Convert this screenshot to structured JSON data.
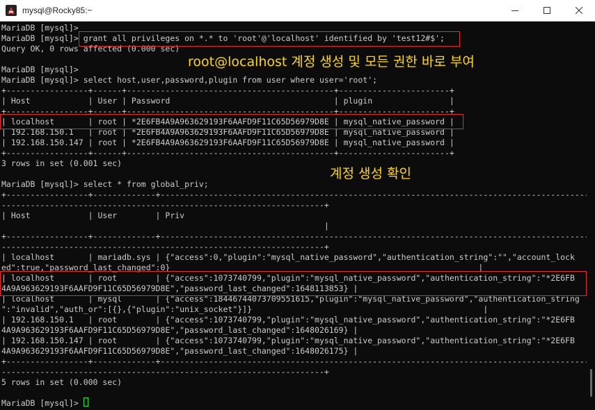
{
  "window": {
    "title": "mysql@Rocky85:~",
    "min_label": "minimize",
    "max_label": "maximize",
    "close_label": "close"
  },
  "terminal": {
    "lines": [
      "MariaDB [mysql]>",
      "MariaDB [mysql]> grant all privileges on *.* to 'root'@'localhost' identified by 'test12#$';",
      "Query OK, 0 rows affected (0.000 sec)",
      "",
      "MariaDB [mysql]>",
      "MariaDB [mysql]> select host,user,password,plugin from user where user='root';",
      "+-----------------+------+-------------------------------------------+-----------------------+",
      "| Host            | User | Password                                  | plugin                |",
      "+-----------------+------+-------------------------------------------+-----------------------+",
      "| localhost       | root | *2E6FB4A9A963629193F6AAFD9F11C65D56979D8E | mysql_native_password |",
      "| 192.168.150.1   | root | *2E6FB4A9A963629193F6AAFD9F11C65D56979D8E | mysql_native_password |",
      "| 192.168.150.147 | root | *2E6FB4A9A963629193F6AAFD9F11C65D56979D8E | mysql_native_password |",
      "+-----------------+------+-------------------------------------------+-----------------------+",
      "3 rows in set (0.001 sec)",
      "",
      "MariaDB [mysql]> select * from global_priv;",
      "+-----------------+-------------+--------------------------------------------------------------------------------------------------------------",
      "-------------------------------------------------------------------+",
      "| Host            | User        | Priv",
      "                                                                   |",
      "+-----------------+-------------+--------------------------------------------------------------------------------------------------------------",
      "-------------------------------------------------------------------+",
      "| localhost       | mariadb.sys | {\"access\":0,\"plugin\":\"mysql_native_password\",\"authentication_string\":\"\",\"account_lock",
      "ed\":true,\"password_last_changed\":0}                                                                |",
      "| localhost       | root        | {\"access\":1073740799,\"plugin\":\"mysql_native_password\",\"authentication_string\":\"*2E6FB",
      "4A9A963629193F6AAFD9F11C65D56979D8E\",\"password_last_changed\":1648113853} |",
      "| localhost       | mysql       | {\"access\":18446744073709551615,\"plugin\":\"mysql_native_password\",\"authentication_string",
      "\":\"invalid\",\"auth_or\":[{},{\"plugin\":\"unix_socket\"}]}                                                |",
      "| 192.168.150.1   | root        | {\"access\":1073740799,\"plugin\":\"mysql_native_password\",\"authentication_string\":\"*2E6FB",
      "4A9A963629193F6AAFD9F11C65D56979D8E\",\"password_last_changed\":1648026169} |",
      "| 192.168.150.147 | root        | {\"access\":1073740799,\"plugin\":\"mysql_native_password\",\"authentication_string\":\"*2E6FB",
      "4A9A963629193F6AAFD9F11C65D56979D8E\",\"password_last_changed\":1648026175} |",
      "+-----------------+-------------+--------------------------------------------------------------------------------------------------------------",
      "-------------------------------------------------------------------+",
      "5 rows in set (0.000 sec)",
      "",
      "MariaDB [mysql]> "
    ]
  },
  "annotations": {
    "grant_note": "root@localhost 계정 생성 및 모든 권한 바로 부여",
    "verify_note": "계정 생성 확인"
  },
  "colors": {
    "highlight_box": "#e03030",
    "annotation": "#ffd800",
    "cursor": "#2ee04a",
    "text": "#cccccc",
    "background": "#0c0c0c"
  }
}
